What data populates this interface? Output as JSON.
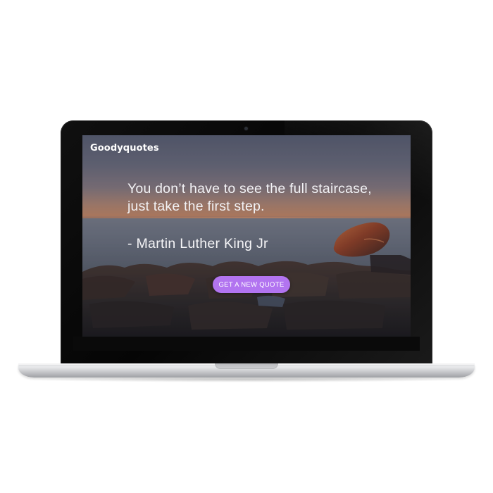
{
  "app": {
    "brand": "Goodyquotes"
  },
  "quote": {
    "text": "You don’t have to see the full staircase, just take the first step.",
    "author": "- Martin Luther King Jr"
  },
  "actions": {
    "new_quote_label": "GET A NEW QUOTE"
  },
  "colors": {
    "accent_button": "#b274f0",
    "text": "#f2f2f5"
  }
}
